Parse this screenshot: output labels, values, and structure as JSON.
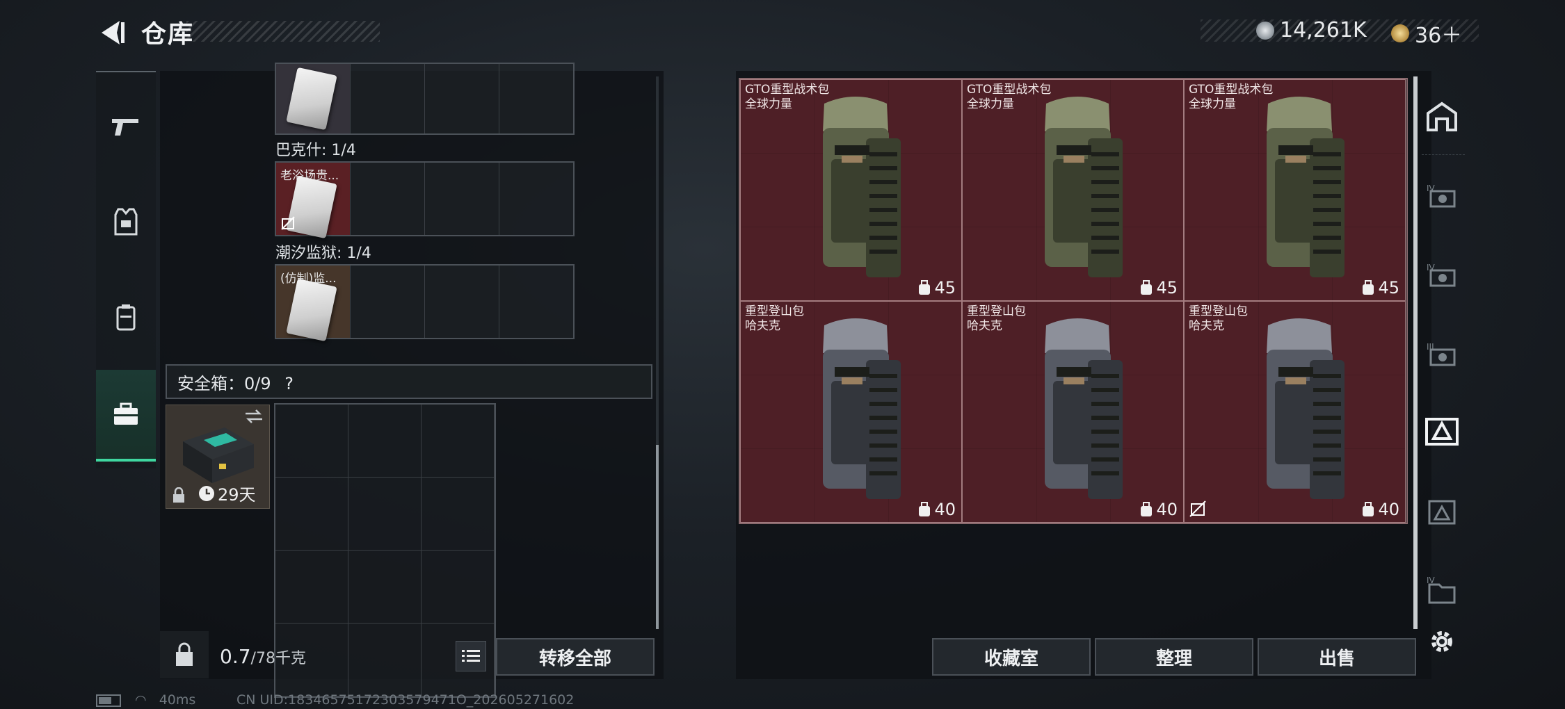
{
  "header": {
    "title": "仓库",
    "currency_a": "14,261K",
    "currency_b": "36＋",
    "currency_a_color": "#9aa3ab",
    "currency_b_color": "#d8b46a"
  },
  "left": {
    "sections": [
      {
        "label": "巴克什: 1/4",
        "item_tag": "老浴场贵..."
      },
      {
        "label": "潮汐监狱: 1/4",
        "item_tag": "(仿制)监..."
      }
    ],
    "safe_box": {
      "label": "安全箱：0/9",
      "help": "?",
      "timer": "29天"
    },
    "weight_value": "0.7",
    "weight_max": "/78千克",
    "transfer_all": "转移全部"
  },
  "right": {
    "bags": [
      {
        "line1": "GTO重型战术包",
        "line2": "全球力量",
        "capacity": "45",
        "color": "green"
      },
      {
        "line1": "GTO重型战术包",
        "line2": "全球力量",
        "capacity": "45",
        "color": "green"
      },
      {
        "line1": "GTO重型战术包",
        "line2": "全球力量",
        "capacity": "45",
        "color": "green"
      },
      {
        "line1": "重型登山包",
        "line2": "哈夫克",
        "capacity": "40",
        "color": "gray"
      },
      {
        "line1": "重型登山包",
        "line2": "哈夫克",
        "capacity": "40",
        "color": "gray"
      },
      {
        "line1": "重型登山包",
        "line2": "哈夫克",
        "capacity": "40",
        "color": "gray"
      }
    ],
    "buttons": {
      "collection": "收藏室",
      "organize": "整理",
      "sell": "出售"
    }
  },
  "status": {
    "ping": "40ms",
    "uid": "CN UID:18346575172303579471O_202605271602"
  }
}
